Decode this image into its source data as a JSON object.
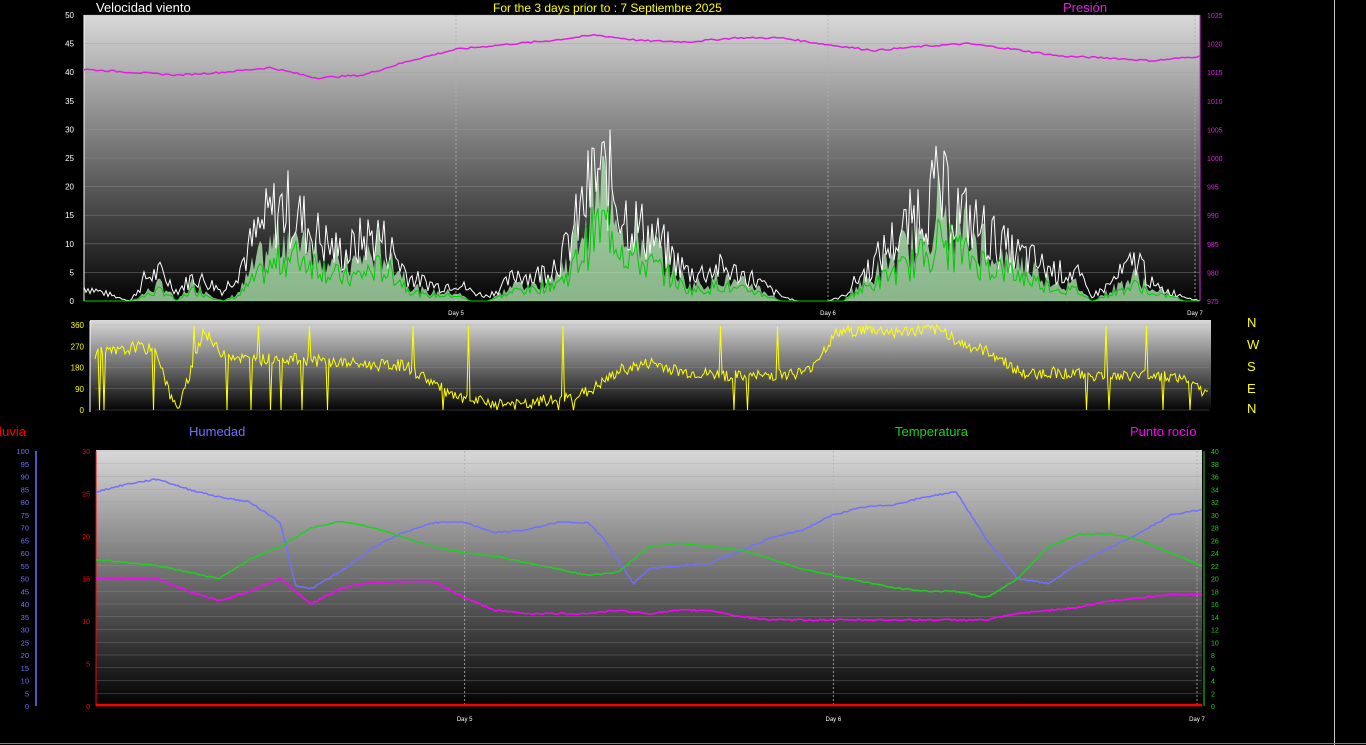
{
  "header": {
    "wind_title": "Velocidad viento",
    "period_title": "For the 3 days prior to : 7 Septiembre 2025",
    "pressure_title": "Presión"
  },
  "compass_letters": [
    "N",
    "W",
    "S",
    "E",
    "N"
  ],
  "legend": {
    "rain": "Lluvia",
    "humidity": "Humedad",
    "temperature": "Temperatura",
    "dewpoint": "Punto rocío"
  },
  "colors": {
    "background_top": "#d8d8d8",
    "background_bottom": "#000000",
    "wind_gust": "#ffffff",
    "wind_avg": "#00cc00",
    "wind_fill": "#b8f0b8",
    "pressure": "#e020e0",
    "direction": "#ffff00",
    "humidity": "#7070ff",
    "temperature": "#20d020",
    "dewpoint": "#ff00ff",
    "rain": "#ff0000",
    "title_white": "#ffffff",
    "title_yellow": "#ffff00"
  },
  "chart_data": [
    {
      "type": "line",
      "name": "wind",
      "x_ticks": [
        "Day 5",
        "Day 6",
        "Day 7"
      ],
      "y_left_ticks": [
        "0",
        "5",
        "10",
        "15",
        "20",
        "25",
        "30",
        "35",
        "40",
        "45",
        "50"
      ],
      "y_left_range": [
        0,
        50
      ],
      "y_right_ticks": [
        "975",
        "980",
        "985",
        "990",
        "995",
        "1000",
        "1005",
        "1010",
        "1015",
        "1020",
        "1025"
      ],
      "y_right_range": [
        975,
        1025
      ],
      "x_range_hours": [
        0,
        72
      ],
      "series": [
        {
          "key": "gust",
          "hours": [
            0,
            3,
            4,
            5,
            6,
            7,
            8,
            9,
            10,
            11,
            12,
            13,
            14,
            15,
            16,
            17,
            18,
            19,
            20,
            21,
            22,
            23,
            24,
            25,
            26,
            27,
            28,
            29,
            30,
            31,
            32,
            33,
            34,
            35,
            36,
            37,
            38,
            39,
            40,
            41,
            42,
            43,
            44,
            45,
            46,
            47,
            48,
            49,
            50,
            51,
            52,
            53,
            54,
            55,
            56,
            57,
            58,
            59,
            60,
            61,
            62,
            63,
            64,
            65,
            66,
            67,
            68,
            69,
            70,
            71,
            72
          ],
          "values": [
            3,
            0,
            5,
            6,
            2,
            5,
            4,
            2,
            7,
            13,
            18,
            20,
            17,
            14,
            11,
            10,
            13,
            14,
            10,
            5,
            4,
            3,
            4,
            2,
            1,
            3,
            6,
            5,
            7,
            10,
            18,
            27,
            25,
            18,
            15,
            13,
            9,
            6,
            6,
            7,
            6,
            5,
            3,
            1,
            0,
            0,
            0,
            1,
            5,
            8,
            12,
            15,
            20,
            23,
            21,
            17,
            15,
            12,
            10,
            9,
            7,
            6,
            6,
            1,
            3,
            6,
            9,
            3,
            2,
            1,
            0
          ]
        },
        {
          "key": "average",
          "hours": [
            0,
            3,
            4,
            5,
            6,
            7,
            8,
            9,
            10,
            11,
            12,
            13,
            14,
            15,
            16,
            17,
            18,
            19,
            20,
            21,
            22,
            23,
            24,
            25,
            26,
            27,
            28,
            29,
            30,
            31,
            32,
            33,
            34,
            35,
            36,
            37,
            38,
            39,
            40,
            41,
            42,
            43,
            44,
            45,
            46,
            47,
            48,
            49,
            50,
            51,
            52,
            53,
            54,
            55,
            56,
            57,
            58,
            59,
            60,
            61,
            62,
            63,
            64,
            65,
            66,
            67,
            68,
            69,
            70,
            71,
            72
          ],
          "values": [
            0,
            0,
            1,
            2,
            0,
            2,
            1,
            0,
            1,
            4,
            6,
            8,
            8,
            7,
            5,
            4,
            5,
            6,
            5,
            2,
            1,
            1,
            1,
            0,
            0,
            1,
            2,
            2,
            3,
            4,
            8,
            13,
            14,
            9,
            7,
            6,
            4,
            2,
            2,
            3,
            2,
            2,
            1,
            0,
            0,
            0,
            0,
            0,
            2,
            3,
            5,
            6,
            8,
            11,
            10,
            8,
            7,
            6,
            5,
            4,
            3,
            2,
            2,
            0,
            1,
            2,
            3,
            1,
            1,
            0,
            0
          ]
        }
      ],
      "pressure": {
        "hours": [
          0,
          6,
          9,
          12,
          15,
          18,
          21,
          24,
          27,
          30,
          33,
          36,
          39,
          42,
          45,
          48,
          51,
          54,
          57,
          60,
          63,
          66,
          69,
          72
        ],
        "values": [
          1015.5,
          1014.5,
          1015.0,
          1015.8,
          1014.0,
          1014.5,
          1017.0,
          1019.0,
          1019.8,
          1020.5,
          1021.5,
          1020.5,
          1020.3,
          1021.0,
          1021.0,
          1019.8,
          1018.8,
          1019.5,
          1020.0,
          1019.0,
          1017.8,
          1017.5,
          1017.0,
          1017.8
        ]
      }
    },
    {
      "type": "line",
      "name": "wind-direction",
      "x_range_hours": [
        0,
        72
      ],
      "y_ticks": [
        "0",
        "90",
        "180",
        "270",
        "360"
      ],
      "y_range": [
        0,
        360
      ],
      "hours": [
        0,
        2,
        2.5,
        4,
        5,
        5.5,
        7,
        8,
        10,
        12,
        14,
        16,
        18,
        20,
        22,
        23,
        24,
        26,
        28,
        29,
        30,
        32,
        34,
        36,
        38,
        40,
        42,
        44,
        46,
        48,
        50,
        52,
        54,
        55,
        56,
        58,
        60,
        62,
        64,
        66,
        68,
        70,
        71,
        72
      ],
      "values": [
        240,
        250,
        270,
        250,
        30,
        20,
        340,
        250,
        210,
        220,
        210,
        200,
        190,
        190,
        110,
        60,
        40,
        30,
        20,
        40,
        40,
        80,
        170,
        200,
        160,
        150,
        140,
        150,
        160,
        330,
        340,
        330,
        340,
        330,
        280,
        240,
        150,
        160,
        150,
        140,
        150,
        140,
        100,
        60
      ]
    },
    {
      "type": "line",
      "name": "temp-humidity",
      "x_ticks": [
        "Day 5",
        "Day 6",
        "Day 7"
      ],
      "rain_ticks": [
        "0",
        "5",
        "10",
        "15",
        "20",
        "25",
        "30"
      ],
      "rain_range": [
        0,
        30
      ],
      "humidity_ticks": [
        "0",
        "5",
        "10",
        "15",
        "20",
        "25",
        "30",
        "35",
        "40",
        "45",
        "50",
        "55",
        "60",
        "65",
        "70",
        "75",
        "80",
        "85",
        "90",
        "95",
        "100"
      ],
      "humidity_range": [
        0,
        100
      ],
      "temperature_ticks": [
        "0",
        "2",
        "4",
        "6",
        "8",
        "10",
        "12",
        "14",
        "16",
        "18",
        "20",
        "22",
        "24",
        "26",
        "28",
        "30",
        "32",
        "34",
        "36",
        "38",
        "40"
      ],
      "temperature_range": [
        0,
        40
      ],
      "x_range_hours": [
        0,
        72
      ],
      "series": [
        {
          "key": "humidity",
          "hours": [
            0,
            2,
            4,
            6,
            8,
            10,
            12,
            13,
            14,
            16,
            18,
            20,
            22,
            24,
            26,
            28,
            30,
            32,
            33,
            35,
            36,
            38,
            40,
            42,
            44,
            46,
            48,
            50,
            52,
            54,
            56,
            58,
            60,
            62,
            64,
            66,
            68,
            70,
            72
          ],
          "values": [
            84,
            87,
            89,
            85,
            82,
            80,
            72,
            47,
            46,
            53,
            62,
            68,
            72,
            72,
            68,
            69,
            72,
            72,
            66,
            48,
            54,
            55,
            56,
            61,
            66,
            69,
            75,
            78,
            79,
            82,
            84,
            65,
            50,
            48,
            56,
            62,
            68,
            75,
            77
          ]
        },
        {
          "key": "temperature",
          "hours": [
            0,
            2,
            4,
            6,
            8,
            10,
            12,
            14,
            16,
            18,
            20,
            22,
            24,
            26,
            28,
            30,
            32,
            34,
            36,
            38,
            40,
            42,
            44,
            46,
            48,
            50,
            52,
            54,
            56,
            58,
            60,
            62,
            64,
            66,
            68,
            70,
            72
          ],
          "values": [
            23,
            22.5,
            22,
            21,
            20,
            23,
            25,
            28,
            29,
            28,
            26.5,
            25,
            24,
            23.5,
            22.5,
            21.5,
            20.5,
            21,
            25,
            25.5,
            25,
            24.5,
            23,
            21.5,
            20.5,
            19.5,
            18.5,
            18,
            18,
            17,
            20,
            25,
            27,
            27,
            26,
            24,
            22
          ]
        },
        {
          "key": "dewpoint",
          "hours": [
            0,
            2,
            4,
            6,
            8,
            10,
            12,
            13,
            14,
            16,
            18,
            20,
            22,
            24,
            26,
            28,
            30,
            32,
            34,
            36,
            38,
            40,
            42,
            44,
            46,
            48,
            50,
            52,
            54,
            56,
            58,
            60,
            62,
            64,
            66,
            68,
            70,
            72
          ],
          "values": [
            20,
            20,
            20,
            18,
            16.5,
            18,
            20,
            18,
            16,
            18.5,
            19.5,
            19.5,
            19.5,
            17,
            15,
            14.5,
            14.5,
            14.5,
            15,
            14.5,
            15,
            15,
            14,
            13.5,
            13.5,
            13.5,
            13.5,
            13.5,
            13.5,
            13.5,
            13.5,
            14.5,
            15,
            15.5,
            16.5,
            17,
            17.5,
            17.5
          ]
        },
        {
          "key": "rain",
          "hours": [
            0,
            72
          ],
          "values": [
            0,
            0
          ]
        }
      ]
    }
  ]
}
